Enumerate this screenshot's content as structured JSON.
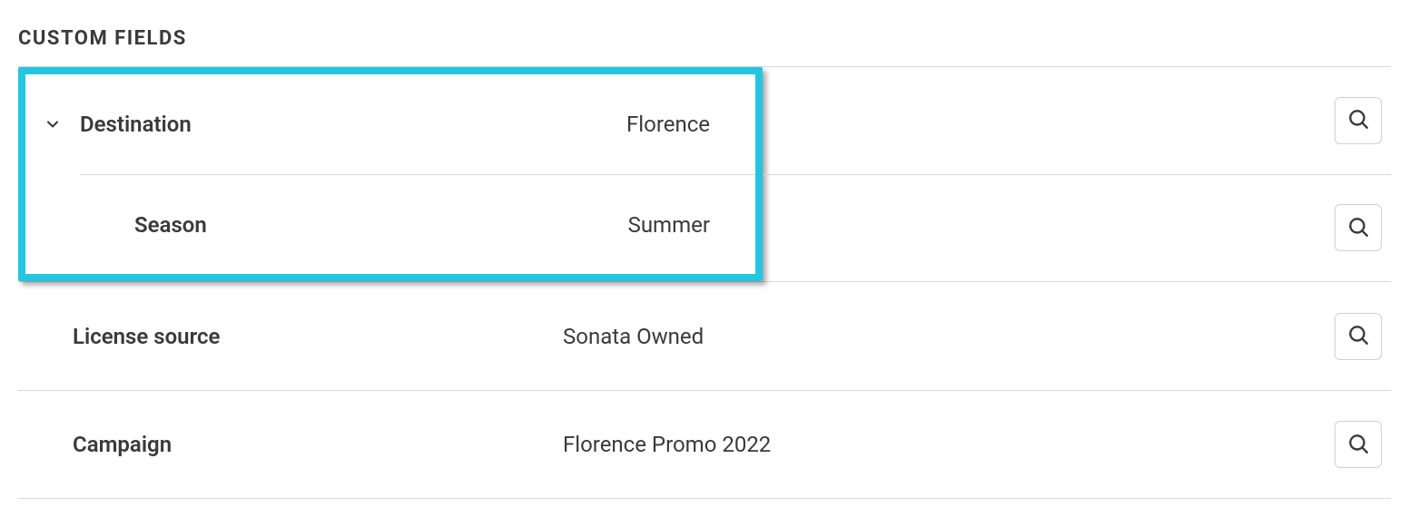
{
  "section": {
    "title": "CUSTOM FIELDS"
  },
  "fields": {
    "destination": {
      "label": "Destination",
      "value": "Florence"
    },
    "season": {
      "label": "Season",
      "value": "Summer"
    },
    "license_source": {
      "label": "License source",
      "value": "Sonata Owned"
    },
    "campaign": {
      "label": "Campaign",
      "value": "Florence Promo 2022"
    }
  }
}
